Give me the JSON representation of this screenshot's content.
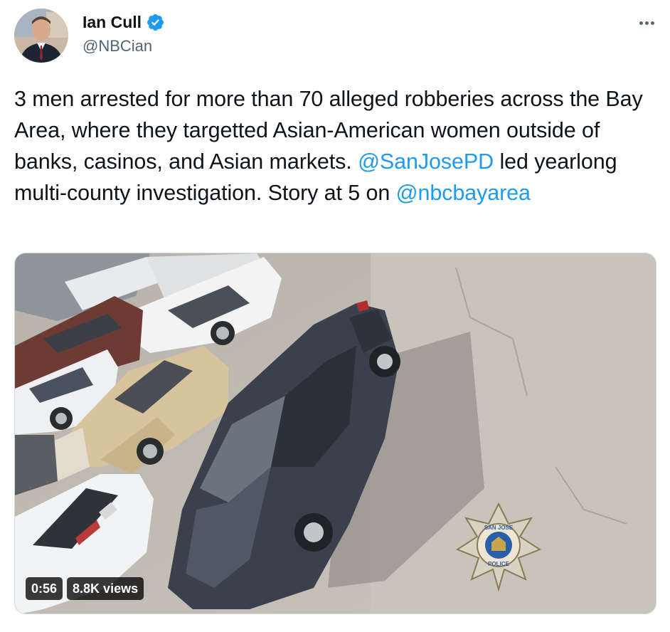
{
  "author": {
    "display_name": "Ian Cull",
    "handle": "@NBCian",
    "verified": true,
    "avatar_icon": "avatar-photo"
  },
  "menu": {
    "icon": "more-dots-icon"
  },
  "tweet": {
    "segments": [
      {
        "type": "text",
        "text": "3 men arrested for more than 70 alleged robberies across the Bay Area, where they targetted Asian-American women outside of banks, casinos, and Asian markets. "
      },
      {
        "type": "mention",
        "text": "@SanJosePD"
      },
      {
        "type": "text",
        "text": " led yearlong multi-county investigation. Story at 5 on "
      },
      {
        "type": "mention",
        "text": "@nbcbayarea"
      }
    ]
  },
  "media": {
    "type": "video",
    "duration": "0:56",
    "views": "8.8K views",
    "watermark_icon": "san-jose-police-badge-icon"
  },
  "colors": {
    "accent": "#1d9bf0",
    "text": "#0f1419",
    "secondary": "#536471"
  }
}
